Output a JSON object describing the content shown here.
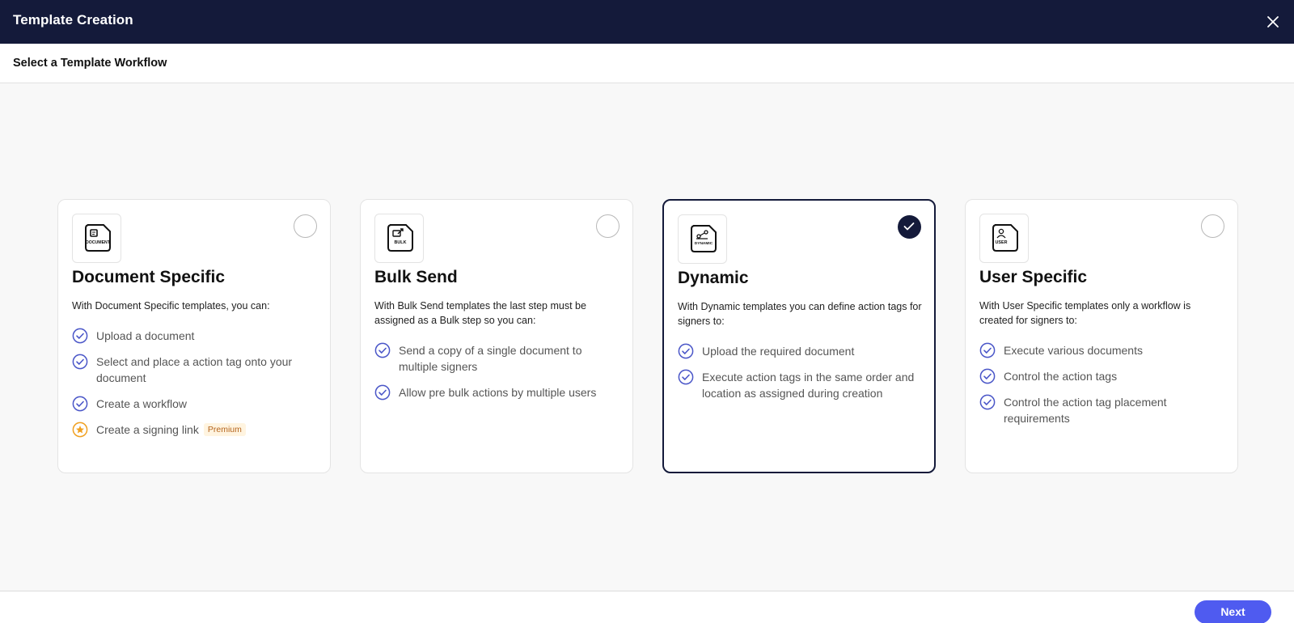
{
  "header": {
    "title": "Template Creation",
    "close_icon": "close-icon"
  },
  "subheader": {
    "title": "Select a Template Workflow"
  },
  "colors": {
    "header_bg": "#141a3a",
    "accent": "#4f5bf0",
    "check_color": "#4a56c8",
    "premium_color": "#f0a020"
  },
  "cards": [
    {
      "icon_label": "DOCUMENT",
      "title": "Document Specific",
      "description": "With Document Specific templates, you can:",
      "selected": false,
      "features": [
        "Upload a document",
        "Select and place a action tag onto your document",
        "Create a workflow",
        "Create a signing link"
      ],
      "premium_badge": "Premium"
    },
    {
      "icon_label": "BULK",
      "title": "Bulk Send",
      "description": "With Bulk Send templates the last step must be assigned as a Bulk step so you can:",
      "selected": false,
      "features": [
        "Send a copy of a single document to multiple signers",
        "Allow pre bulk actions by multiple users"
      ]
    },
    {
      "icon_label": "DYNAMIC",
      "title": "Dynamic",
      "description": "With Dynamic templates you can define action tags for signers to:",
      "selected": true,
      "features": [
        "Upload the required document",
        "Execute action tags in the same order and location as assigned during creation"
      ]
    },
    {
      "icon_label": "USER",
      "title": "User Specific",
      "description": "With User Specific templates only a workflow is created for signers to:",
      "selected": false,
      "features": [
        "Execute various documents",
        "Control the action tags",
        "Control the action tag placement requirements"
      ]
    }
  ],
  "footer": {
    "next_label": "Next"
  }
}
